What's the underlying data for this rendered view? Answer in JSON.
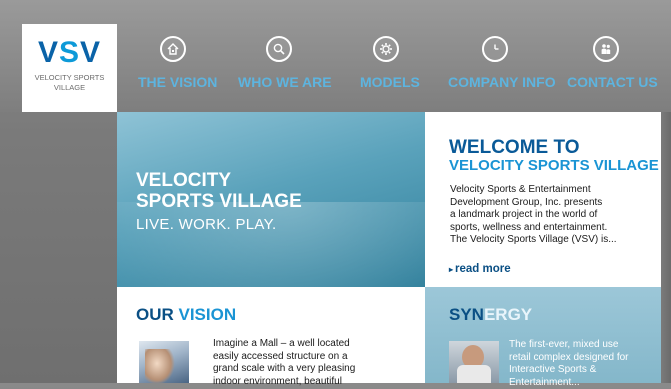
{
  "logo": {
    "mark_v": "V",
    "mark_s": "S",
    "mark_v2": "V",
    "line1": "VELOCITY SPORTS",
    "line2": "VILLAGE"
  },
  "nav": [
    {
      "label": "THE VISION",
      "icon": "home-icon"
    },
    {
      "label": "WHO WE ARE",
      "icon": "search-icon"
    },
    {
      "label": "MODELS",
      "icon": "gear-icon"
    },
    {
      "label": "COMPANY INFO",
      "icon": "clock-icon"
    },
    {
      "label": "CONTACT US",
      "icon": "people-icon"
    }
  ],
  "hero": {
    "title_line1": "VELOCITY",
    "title_line2": "SPORTS VILLAGE",
    "tagline": "LIVE. WORK. PLAY."
  },
  "welcome": {
    "heading1": "WELCOME TO",
    "heading2": "VELOCITY SPORTS VILLAGE",
    "body_lines": [
      "Velocity Sports & Entertainment",
      "Development Group, Inc. presents",
      "a landmark project in the world of",
      "sports, wellness and entertainment.",
      "The Velocity Sports Village (VSV) is..."
    ],
    "read_more": "read more"
  },
  "vision": {
    "heading_a": "OUR ",
    "heading_b": "VISION",
    "body_lines": [
      "Imagine a Mall – a well located",
      "easily accessed structure on a",
      "grand scale with a very pleasing",
      "indoor environment, beautiful"
    ]
  },
  "synergy": {
    "heading_a": "SYN",
    "heading_b": "ERGY",
    "body_lines": [
      "The first-ever, mixed use",
      "retail complex designed for",
      "Interactive Sports &",
      "Entertainment..."
    ]
  },
  "colors": {
    "navy": "#0a4f84",
    "blue": "#1a94d4",
    "nav_label": "#5db4df",
    "hero_blue": "#5aa2bb"
  }
}
